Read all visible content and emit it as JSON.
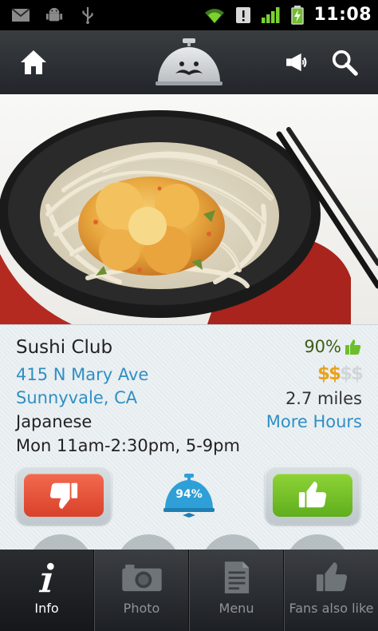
{
  "status_bar": {
    "time": "11:08",
    "icons": [
      "mail-icon",
      "android-debug-icon",
      "usb-icon",
      "wifi-icon",
      "alert-icon",
      "signal-icon",
      "battery-charging-icon"
    ]
  },
  "action_bar": {
    "icons": [
      "home-icon",
      "waiter-bell-logo",
      "megaphone-icon",
      "search-icon"
    ]
  },
  "restaurant": {
    "name": "Sushi Club",
    "address_line1": "415 N Mary Ave",
    "address_line2": "Sunnyvale, CA",
    "cuisine": "Japanese",
    "hours": "Mon 11am-2:30pm, 5-9pm",
    "rating": "90%",
    "price_on": "$$",
    "price_off": "$$",
    "distance": "2.7 miles",
    "more_hours_label": "More Hours",
    "score": "94%"
  },
  "colors": {
    "link": "#2f8fc4",
    "dislike": "#e0522f",
    "like": "#74c02a",
    "price_active": "#e8a21d",
    "score_bell": "#2f9fd8"
  },
  "tabs": [
    {
      "label": "Info",
      "icon": "info-icon",
      "active": true
    },
    {
      "label": "Photo",
      "icon": "camera-icon",
      "active": false
    },
    {
      "label": "Menu",
      "icon": "menu-document-icon",
      "active": false
    },
    {
      "label": "Fans also like",
      "icon": "thumbs-up-icon",
      "active": false
    }
  ]
}
